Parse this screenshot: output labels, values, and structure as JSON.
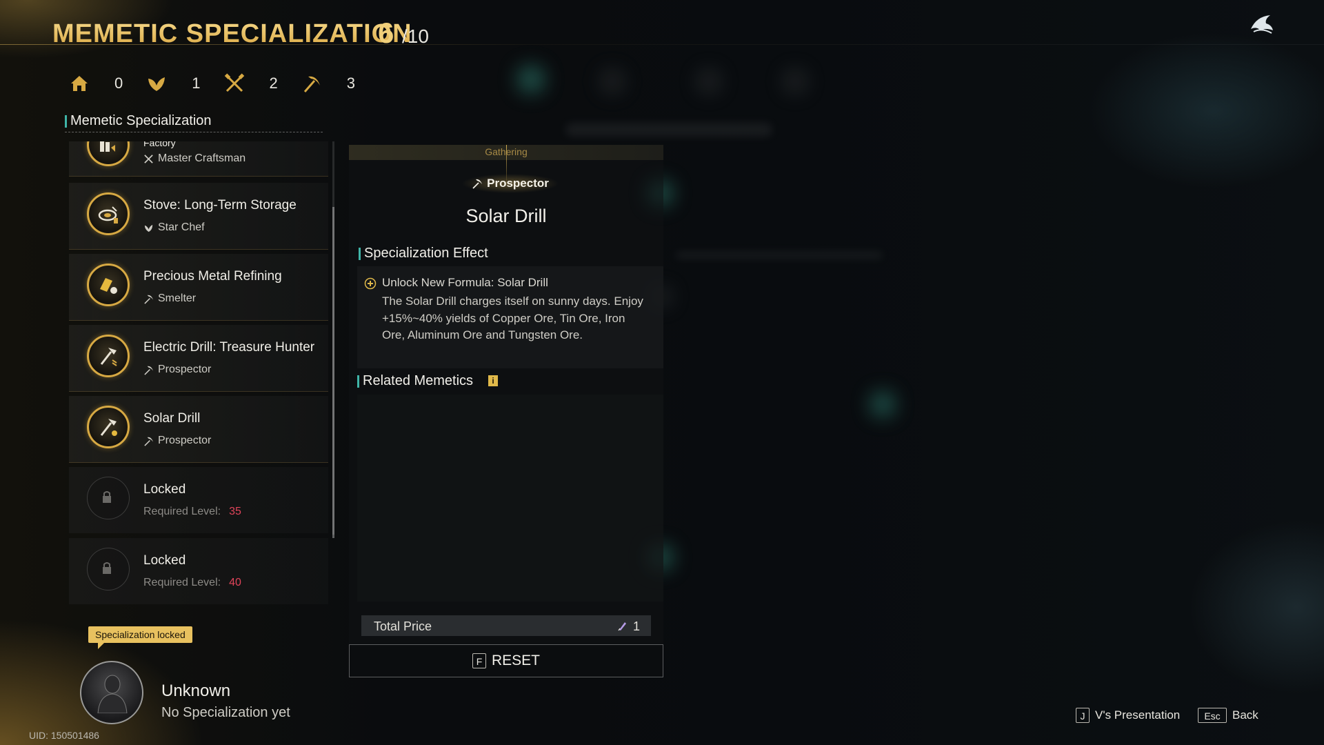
{
  "header": {
    "title": "MEMETIC SPECIALIZATION",
    "count": "6",
    "count_total": "/10"
  },
  "stats": [
    {
      "icon": "home-icon",
      "value": "0"
    },
    {
      "icon": "leaf-icon",
      "value": "1"
    },
    {
      "icon": "crossed-tools-icon",
      "value": "2"
    },
    {
      "icon": "pickaxe-icon",
      "value": "3"
    }
  ],
  "left": {
    "section_title": "Memetic Specialization",
    "items": [
      {
        "name": "Factory",
        "sub": "Master Craftsman",
        "sub_icon": "crossed-tools-icon"
      },
      {
        "name": "Stove: Long-Term Storage",
        "sub": "Star Chef",
        "sub_icon": "leaf-icon"
      },
      {
        "name": "Precious Metal Refining",
        "sub": "Smelter",
        "sub_icon": "pickaxe-icon"
      },
      {
        "name": "Electric Drill: Treasure Hunter",
        "sub": "Prospector",
        "sub_icon": "pickaxe-icon"
      },
      {
        "name": "Solar Drill",
        "sub": "Prospector",
        "sub_icon": "pickaxe-icon"
      },
      {
        "name": "Locked",
        "sub": "Required Level:",
        "level": "35"
      },
      {
        "name": "Locked",
        "sub": "Required Level:",
        "level": "40"
      }
    ]
  },
  "profile": {
    "tooltip": "Specialization locked",
    "name": "Unknown",
    "status": "No Specialization yet",
    "uid": "UID: 150501486"
  },
  "detail": {
    "category": "Gathering",
    "spec": "Prospector",
    "title": "Solar Drill",
    "effect_heading": "Specialization Effect",
    "effect_title": "Unlock New Formula: Solar Drill",
    "effect_desc": "The Solar Drill charges itself on sunny days. Enjoy +15%~40% yields of Copper Ore, Tin Ore, Iron Ore, Aluminum Ore and Tungsten Ore.",
    "related_heading": "Related Memetics",
    "info_glyph": "i",
    "price_label": "Total Price",
    "price_value": "1",
    "reset_key": "F",
    "reset_label": "RESET"
  },
  "footer": {
    "presentation_key": "J",
    "presentation_label": "V's Presentation",
    "back_key": "Esc",
    "back_label": "Back"
  },
  "colors": {
    "gold": "#e9c46a",
    "teal_accent": "#3fb5a8",
    "level_red": "#e0445a"
  }
}
